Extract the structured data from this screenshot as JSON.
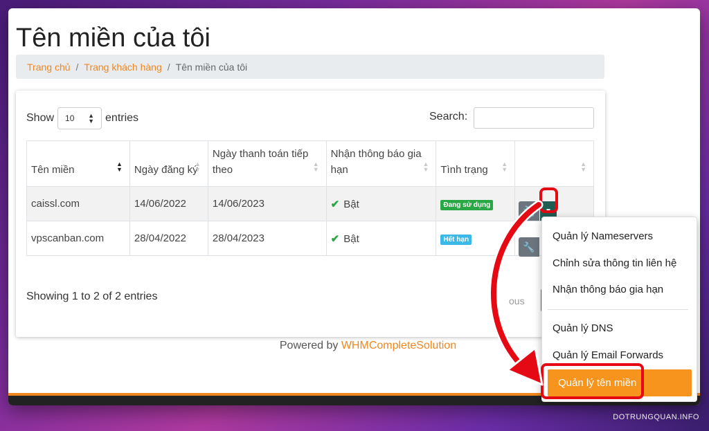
{
  "page": {
    "title": "Tên miền của tôi"
  },
  "breadcrumb": {
    "items": [
      "Trang chủ",
      "Trang khách hàng"
    ],
    "separator": "/",
    "active": "Tên miền của tôi"
  },
  "table_controls": {
    "show_label": "Show",
    "entries_label": "entries",
    "page_length": "10",
    "search_label": "Search:",
    "search_value": ""
  },
  "table": {
    "headers": [
      "Tên miền",
      "Ngày đăng ký",
      "Ngày thanh toán tiếp theo",
      "Nhận thông báo gia hạn",
      "Tình trạng",
      ""
    ],
    "rows": [
      {
        "domain": "caissl.com",
        "registered": "14/06/2022",
        "next_due": "14/06/2023",
        "renewal_notice": "Bật",
        "status": "Đang sử dụng",
        "status_color": "#28a745"
      },
      {
        "domain": "vpscanban.com",
        "registered": "28/04/2022",
        "next_due": "28/04/2023",
        "renewal_notice": "Bật",
        "status": "Hết hạn",
        "status_color": "#3ab8e8"
      }
    ]
  },
  "pagination": {
    "info": "Showing 1 to 2 of 2 entries",
    "previous_partial": "ous"
  },
  "footer": {
    "powered_by": "Powered by",
    "brand": "WHMCompleteSolution"
  },
  "dropdown": {
    "items": [
      "Quản lý Nameservers",
      "Chỉnh sửa thông tin liên hệ",
      "Nhận thông báo gia hạn",
      "Quản lý DNS",
      "Quản lý Email Forwards"
    ],
    "active_item": "Quản lý tên miền"
  },
  "watermark": "DOTRUNGQUAN.INFO",
  "colors": {
    "accent": "#f0861e",
    "annotation": "#e50914",
    "toggle": "#1f5d53"
  },
  "icons": {
    "sort": "sort-icon",
    "check": "check-icon",
    "settings": "wrench-icon",
    "caret": "caret-down-icon"
  }
}
